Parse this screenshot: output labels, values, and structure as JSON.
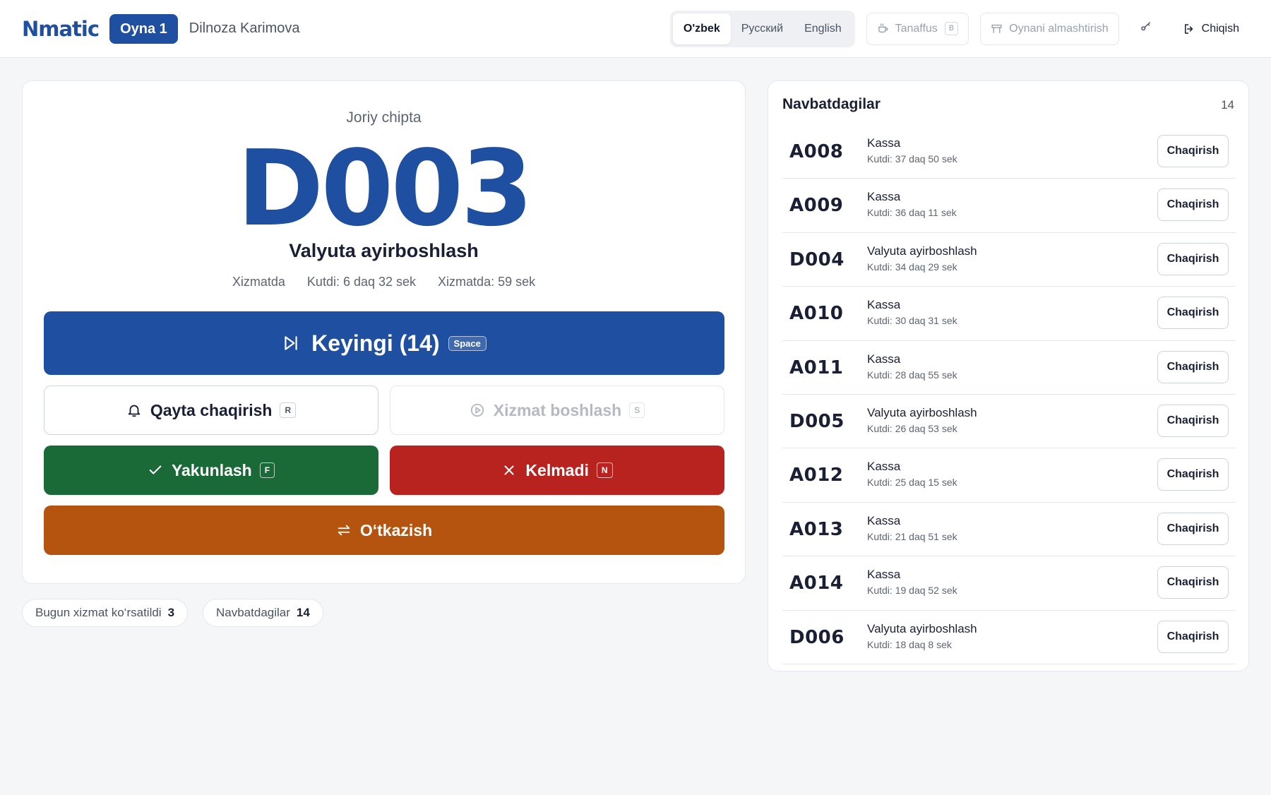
{
  "header": {
    "logo": "Nmatic",
    "window_badge": "Oyna 1",
    "operator": "Dilnoza Karimova",
    "languages": [
      "O'zbek",
      "Русский",
      "English"
    ],
    "active_language": "O'zbek",
    "break_label": "Tanaffus",
    "break_key": "B",
    "change_window_label": "Oynani almashtirish",
    "key_icon": "key-icon",
    "logout_label": "Chiqish"
  },
  "current": {
    "caption": "Joriy chipta",
    "ticket": "D003",
    "service": "Valyuta ayirboshlash",
    "status": "Xizmatda",
    "waited": "Kutdi: 6 daq 32 sek",
    "serving": "Xizmatda: 59 sek"
  },
  "actions": {
    "next_label": "Keyingi (14)",
    "next_key": "Space",
    "recall_label": "Qayta chaqirish",
    "recall_key": "R",
    "start_label": "Xizmat boshlash",
    "start_key": "S",
    "finish_label": "Yakunlash",
    "finish_key": "F",
    "noshow_label": "Kelmadi",
    "noshow_key": "N",
    "transfer_label": "O‘tkazish"
  },
  "stats": {
    "served_label": "Bugun xizmat ko‘rsatildi",
    "served_value": "3",
    "waiting_label": "Navbatdagilar",
    "waiting_value": "14"
  },
  "queue": {
    "title": "Navbatdagilar",
    "count": "14",
    "call_label": "Chaqirish",
    "items": [
      {
        "ticket": "A008",
        "service": "Kassa",
        "wait": "Kutdi: 37 daq 50 sek"
      },
      {
        "ticket": "A009",
        "service": "Kassa",
        "wait": "Kutdi: 36 daq 11 sek"
      },
      {
        "ticket": "D004",
        "service": "Valyuta ayirboshlash",
        "wait": "Kutdi: 34 daq 29 sek"
      },
      {
        "ticket": "A010",
        "service": "Kassa",
        "wait": "Kutdi: 30 daq 31 sek"
      },
      {
        "ticket": "A011",
        "service": "Kassa",
        "wait": "Kutdi: 28 daq 55 sek"
      },
      {
        "ticket": "D005",
        "service": "Valyuta ayirboshlash",
        "wait": "Kutdi: 26 daq 53 sek"
      },
      {
        "ticket": "A012",
        "service": "Kassa",
        "wait": "Kutdi: 25 daq 15 sek"
      },
      {
        "ticket": "A013",
        "service": "Kassa",
        "wait": "Kutdi: 21 daq 51 sek"
      },
      {
        "ticket": "A014",
        "service": "Kassa",
        "wait": "Kutdi: 19 daq 52 sek"
      },
      {
        "ticket": "D006",
        "service": "Valyuta ayirboshlash",
        "wait": "Kutdi: 18 daq 8 sek"
      }
    ]
  },
  "colors": {
    "brand": "#1f4fa0",
    "finish": "#1a6a38",
    "noshow": "#b82320",
    "transfer": "#b5540e"
  }
}
